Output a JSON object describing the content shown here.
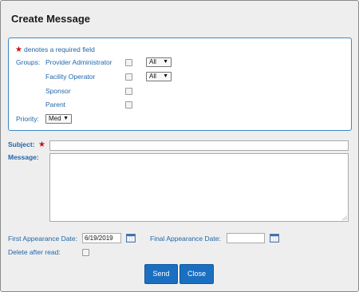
{
  "dialog": {
    "title": "Create Message"
  },
  "required_note": "denotes a required field",
  "groups": {
    "label": "Groups:",
    "items": [
      {
        "label": "Provider Administrator",
        "select_value": "All"
      },
      {
        "label": "Facility Operator",
        "select_value": "All"
      },
      {
        "label": "Sponsor"
      },
      {
        "label": "Parent"
      }
    ]
  },
  "priority": {
    "label": "Priority:",
    "value": "Med"
  },
  "subject": {
    "label": "Subject:",
    "value": ""
  },
  "message": {
    "label": "Message:",
    "value": ""
  },
  "first_appearance": {
    "label": "First Appearance Date:",
    "value": "6/19/2019"
  },
  "final_appearance": {
    "label": "Final Appearance Date:",
    "value": ""
  },
  "delete_after_read": {
    "label": "Delete after read:"
  },
  "buttons": {
    "send": "Send",
    "close": "Close"
  },
  "colors": {
    "accent": "#1b6fc0",
    "label_blue": "#2266aa",
    "required_star": "#cc1111",
    "panel_border": "#3d87c5"
  },
  "icons": {
    "calendar": "calendar-icon",
    "dropdown": "chevron-down-icon",
    "required": "star-icon"
  }
}
